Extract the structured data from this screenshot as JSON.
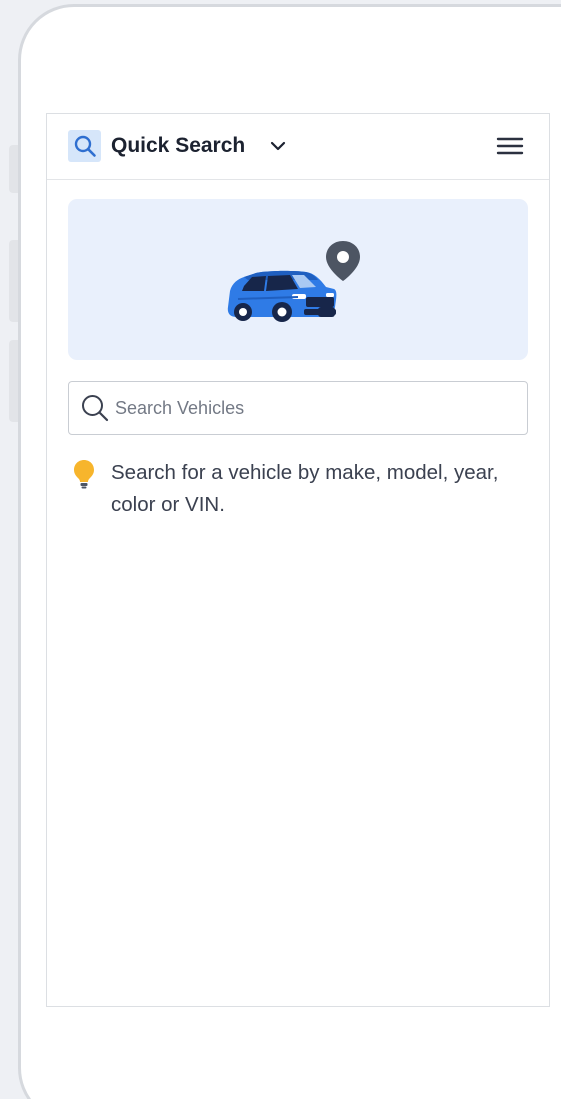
{
  "header": {
    "title": "Quick Search",
    "icon": "search-icon",
    "dropdown_icon": "chevron-down-icon",
    "menu_icon": "hamburger-menu-icon"
  },
  "hero": {
    "illustration": "car-with-location-pin",
    "background": "#e9f0fc"
  },
  "search": {
    "placeholder": "Search Vehicles",
    "value": ""
  },
  "tip": {
    "icon": "lightbulb-icon",
    "text": "Search for a vehicle by make, model, year, color or VIN."
  },
  "colors": {
    "accent": "#2f7be6",
    "car_blue": "#2f7be6",
    "pin_gray": "#4d5563",
    "bulb_yellow": "#f7b52c",
    "title": "#1c2230"
  }
}
